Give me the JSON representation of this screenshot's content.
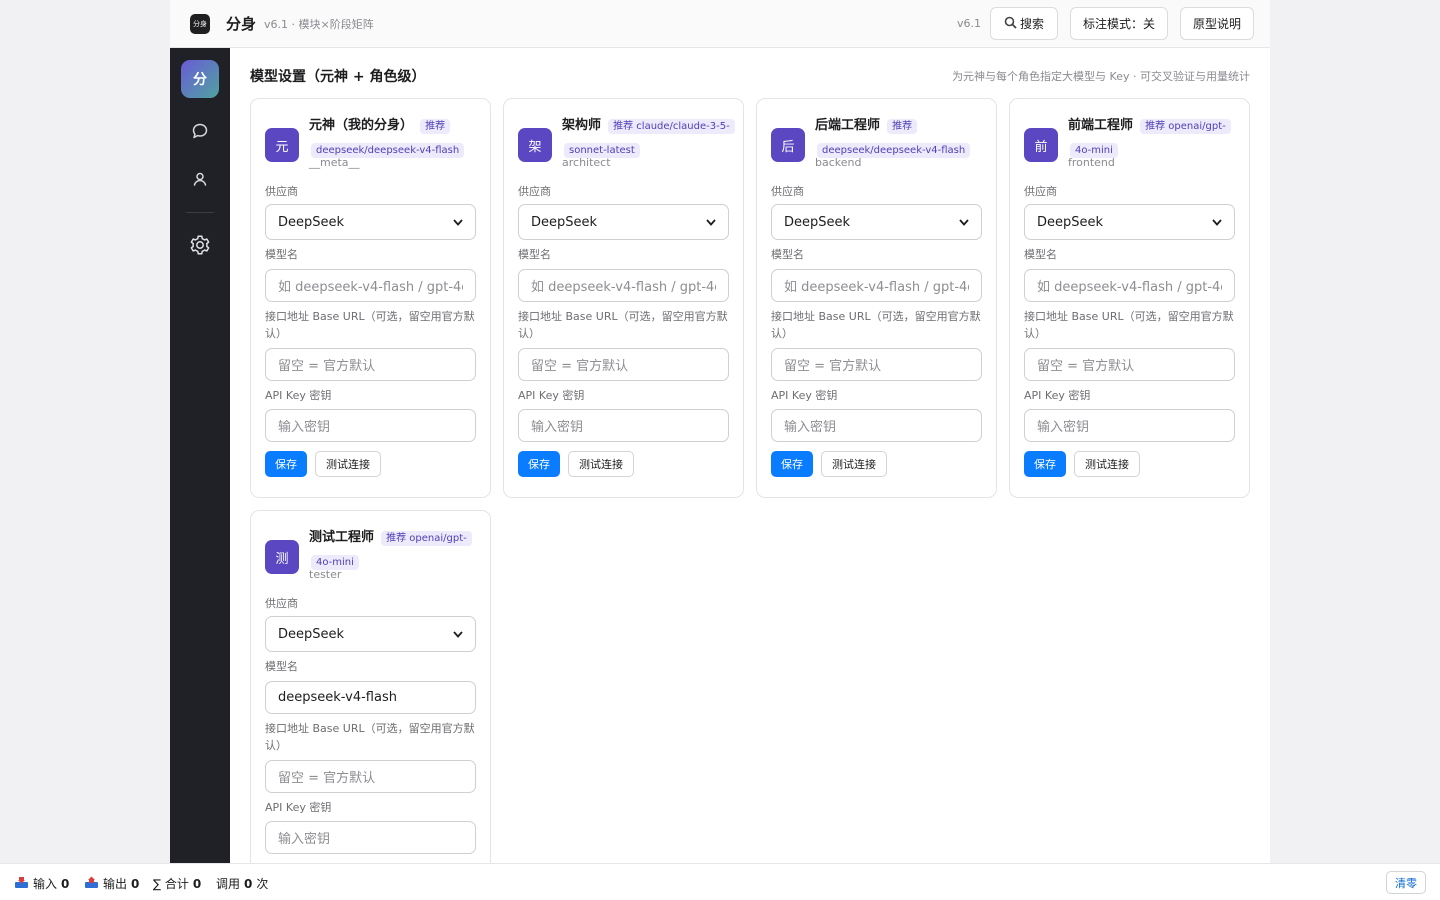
{
  "header": {
    "logo_text": "分身",
    "title": "分身",
    "subtitle": "v6.1 · 模块×阶段矩阵",
    "version": "v6.1",
    "search_label": "搜索",
    "mark_mode_label": "标注模式：关",
    "prototype_label": "原型说明"
  },
  "sidebar": {
    "brand": "分",
    "items": [
      {
        "icon": "chat-bubble-icon"
      },
      {
        "icon": "user-icon"
      },
      {
        "icon": "gear-icon"
      }
    ]
  },
  "page": {
    "title": "模型设置（元神 + 角色级）",
    "description": "为元神与每个角色指定大模型与 Key · 可交叉验证与用量统计"
  },
  "labels": {
    "provider": "供应商",
    "model": "模型名",
    "base_url": "接口地址 Base URL（可选，留空用官方默认）",
    "api_key": "API Key 密钥",
    "save": "保存",
    "test": "测试连接"
  },
  "cards": [
    {
      "avatar": "元",
      "name": "元神（我的分身）",
      "recommend": "推荐 deepseek/deepseek-v4-flash",
      "id": "__meta__",
      "provider": "DeepSeek",
      "model_value": "",
      "model_placeholder": "如 deepseek-v4-flash / gpt-4o",
      "base_url_placeholder": "留空 = 官方默认",
      "key_placeholder": "输入密钥"
    },
    {
      "avatar": "架",
      "name": "架构师",
      "recommend": "推荐 claude/claude-3-5-sonnet-latest",
      "id": "architect",
      "provider": "DeepSeek",
      "model_value": "",
      "model_placeholder": "如 deepseek-v4-flash / gpt-4o",
      "base_url_placeholder": "留空 = 官方默认",
      "key_placeholder": "输入密钥"
    },
    {
      "avatar": "后",
      "name": "后端工程师",
      "recommend": "推荐 deepseek/deepseek-v4-flash",
      "id": "backend",
      "provider": "DeepSeek",
      "model_value": "",
      "model_placeholder": "如 deepseek-v4-flash / gpt-4o",
      "base_url_placeholder": "留空 = 官方默认",
      "key_placeholder": "输入密钥"
    },
    {
      "avatar": "前",
      "name": "前端工程师",
      "recommend": "推荐 openai/gpt-4o-mini",
      "id": "frontend",
      "provider": "DeepSeek",
      "model_value": "",
      "model_placeholder": "如 deepseek-v4-flash / gpt-4o",
      "base_url_placeholder": "留空 = 官方默认",
      "key_placeholder": "输入密钥"
    },
    {
      "avatar": "测",
      "name": "测试工程师",
      "recommend": "推荐 openai/gpt-4o-mini",
      "id": "tester",
      "provider": "DeepSeek",
      "model_value": "deepseek-v4-flash",
      "model_placeholder": "如 deepseek-v4-flash / gpt-4o",
      "base_url_placeholder": "留空 = 官方默认",
      "key_placeholder": "输入密钥"
    }
  ],
  "statusbar": {
    "input_label": "输入",
    "input_value": "0",
    "output_label": "输出",
    "output_value": "0",
    "total_label": "∑ 合计",
    "total_value": "0",
    "calls_label": "调用",
    "calls_value": "0",
    "calls_unit": "次",
    "clear_label": "清零"
  },
  "colors": {
    "accent": "#0a7cff",
    "avatar": "#5b47c2",
    "sidebar": "#1f2126",
    "recommend_bg": "#eceafb",
    "recommend_text": "#5040b8"
  }
}
